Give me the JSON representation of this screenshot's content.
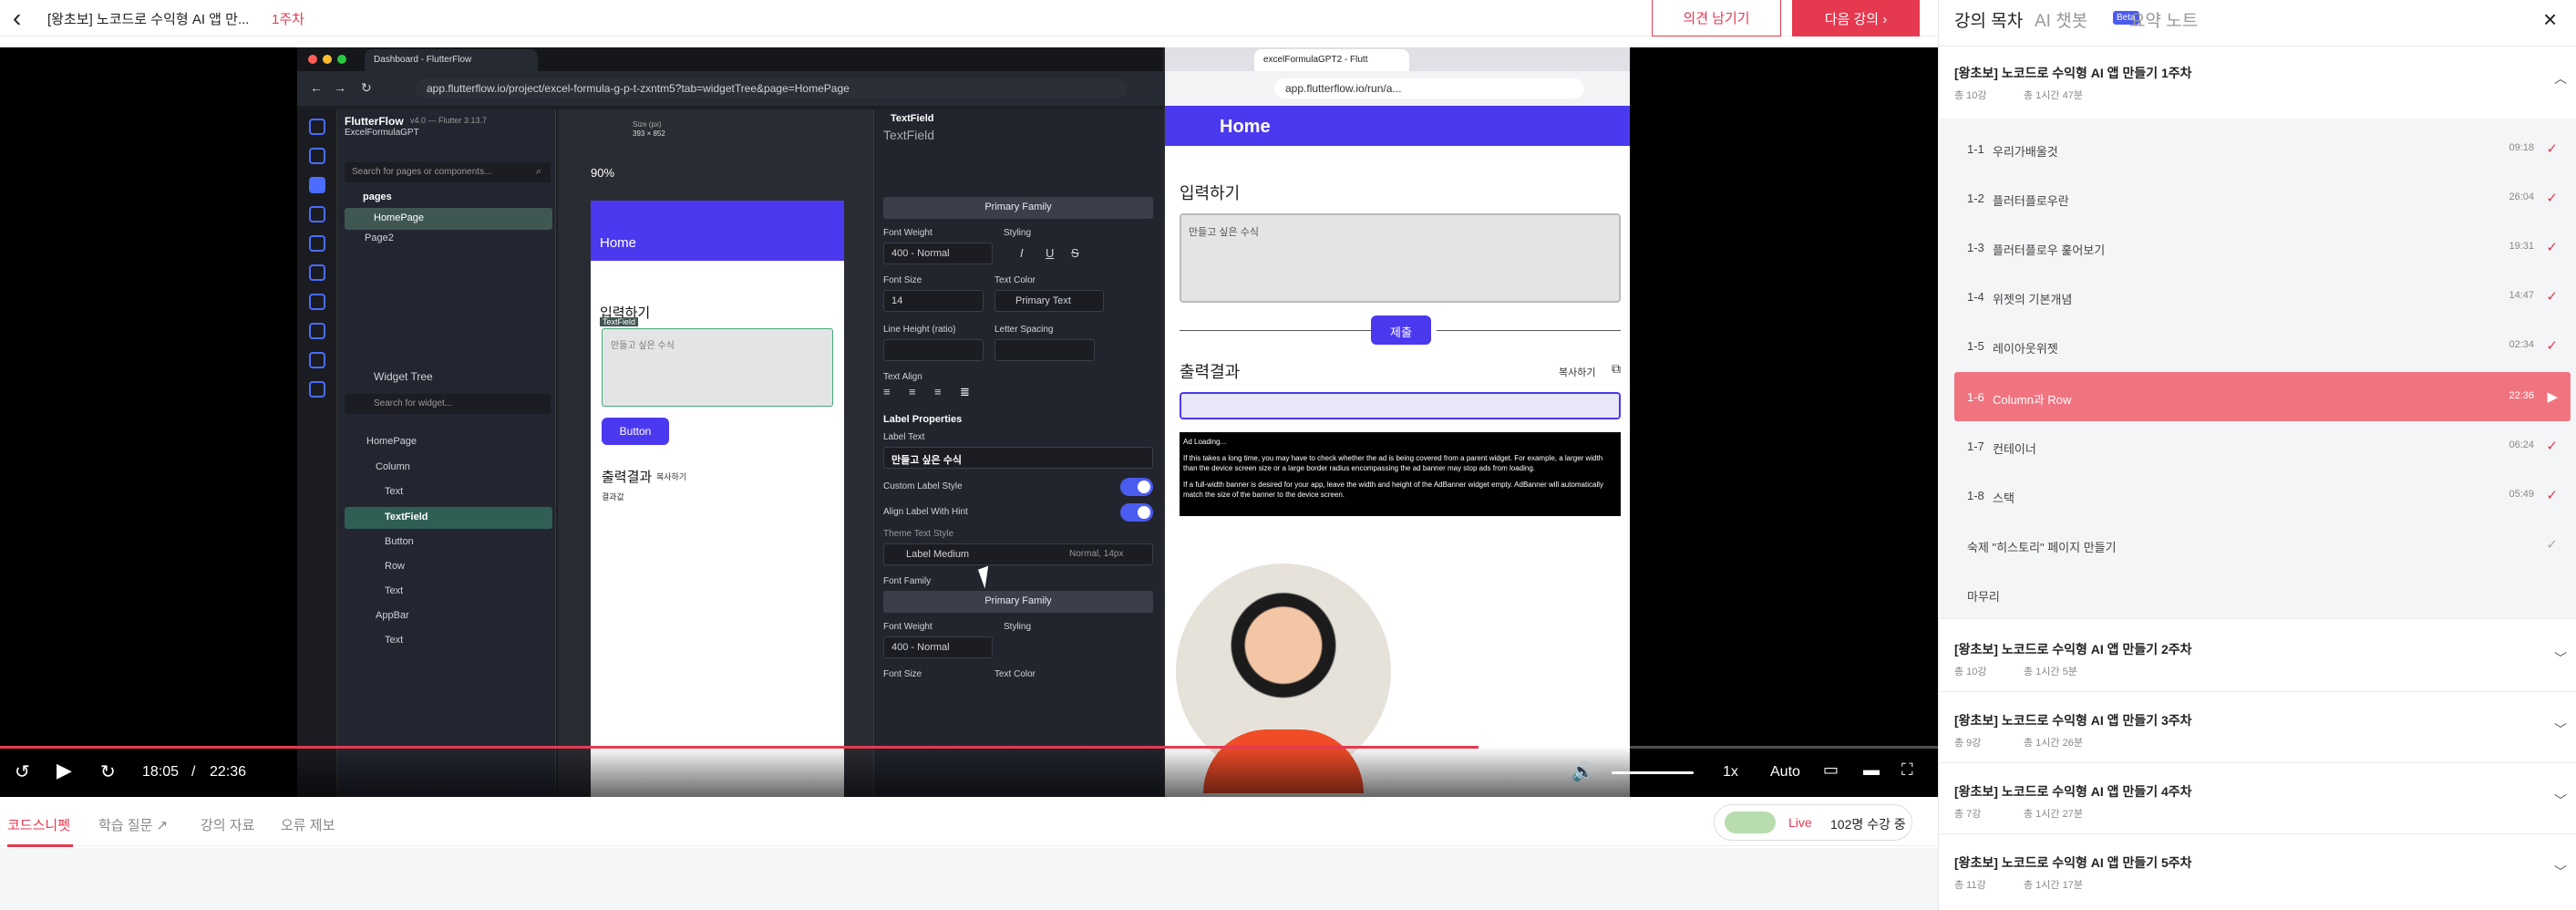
{
  "header": {
    "course_title": "[왕초보] 노코드로 수익형 AI 앱 만...",
    "week": "1주차",
    "feedback_button": "의견 남기기",
    "next_button": "다음 강의 ›"
  },
  "video": {
    "ff_tab": "Dashboard - FlutterFlow",
    "ff_url": "app.flutterflow.io/project/excel-formula-g-p-t-zxntm5?tab=widgetTree&page=HomePage",
    "app_name": "FlutterFlow",
    "app_version": "v4.0 — Flutter 3.13.7",
    "project_name": "ExcelFormulaGPT",
    "zoom": "90%",
    "size_label": "Size (px)",
    "size_value": "393 × 852",
    "search_pages": "Search for pages or components...",
    "pages_label": "pages",
    "page1": "HomePage",
    "page2": "Page2",
    "widget_tree_label": "Widget Tree",
    "search_widget": "Search for widget...",
    "tree": [
      "HomePage",
      "Column",
      "Text",
      "TextField",
      "Button",
      "Row",
      "Text",
      "AppBar",
      "Text"
    ],
    "phone": {
      "appbar_title": "Home",
      "input_heading": "입력하기",
      "textfield_tag": "TextField",
      "hint": "만들고 싶은 수식",
      "button": "Button",
      "output_heading": "출력결과",
      "copy": "복사하기",
      "result": "결과값"
    },
    "props": {
      "title": "TextField",
      "subtitle": "TextField",
      "primary_family": "Primary Family",
      "font_weight_label": "Font Weight",
      "font_weight": "400 - Normal",
      "styling_label": "Styling",
      "font_size_label": "Font Size",
      "font_size": "14",
      "text_color_label": "Text Color",
      "text_color": "Primary Text",
      "line_height_label": "Line Height (ratio)",
      "letter_spacing_label": "Letter Spacing",
      "text_align_label": "Text Align",
      "label_props": "Label Properties",
      "label_text_label": "Label Text",
      "label_text": "만들고 싶은 수식",
      "custom_label_style": "Custom Label Style",
      "align_label": "Align Label With Hint",
      "theme_text_style": "Theme Text Style",
      "label_medium": "Label Medium",
      "label_medium_meta": "Normal, 14px",
      "font_family_label": "Font Family",
      "primary_family2": "Primary Family",
      "font_weight_label2": "Font Weight",
      "font_weight2": "400 - Normal",
      "styling_label2": "Styling",
      "font_size_label2": "Font Size",
      "text_color_label2": "Text Color"
    },
    "run_tab": "excelFormulaGPT2 - Flutt",
    "run_url": "app.flutterflow.io/run/a...",
    "run": {
      "appbar_title": "Home",
      "input_heading": "입력하기",
      "hint": "만들고 싶은 수식",
      "submit": "제출",
      "output_heading": "출력결과",
      "copy": "복사하기",
      "ad_title": "Ad Loading...",
      "ad_p1": "If this takes a long time, you may have to check whether the ad is being covered from a parent widget. For example, a larger width than the device screen size or a large border radius encompassing the ad banner may stop ads from loading.",
      "ad_p2": "If a full-width banner is desired for your app, leave the width and height of the AdBanner widget empty. AdBanner will automatically match the size of the banner to the device screen."
    },
    "controls": {
      "current_time": "18:05",
      "separator": "/",
      "total_time": "22:36",
      "speed": "1x",
      "quality": "Auto",
      "progress": 0.763,
      "volume": 0.9
    }
  },
  "below_tabs": [
    "코드스니펫",
    "학습 질문 ↗",
    "강의 자료",
    "오류 제보"
  ],
  "live": {
    "label": "Live",
    "viewers": "102명 수강 중"
  },
  "sidebar": {
    "tabs": [
      "강의 목차",
      "AI 챗봇",
      "요약 노트"
    ],
    "beta": "Beta",
    "weeks": [
      {
        "title": "[왕초보] 노코드로 수익형 AI 앱 만들기 1주차",
        "count": "총 10강",
        "duration": "총 1시간 47분",
        "lessons": [
          {
            "no": "1-1",
            "title": "우리가배울것",
            "time": "09:18"
          },
          {
            "no": "1-2",
            "title": "플러터플로우란",
            "time": "26:04"
          },
          {
            "no": "1-3",
            "title": "플러터플로우 훑어보기",
            "time": "19:31"
          },
          {
            "no": "1-4",
            "title": "위젯의 기본개념",
            "time": "14:47"
          },
          {
            "no": "1-5",
            "title": "레이아웃위젯",
            "time": "02:34"
          },
          {
            "no": "1-6",
            "title": "Column과 Row",
            "time": "22:36"
          },
          {
            "no": "1-7",
            "title": "컨테이너",
            "time": "06:24"
          },
          {
            "no": "1-8",
            "title": "스택",
            "time": "05:49"
          }
        ],
        "extra": [
          "숙제 \"히스토리\" 페이지 만들기",
          "마무리"
        ]
      },
      {
        "title": "[왕초보] 노코드로 수익형 AI 앱 만들기 2주차",
        "count": "총 10강",
        "duration": "총 1시간 5분"
      },
      {
        "title": "[왕초보] 노코드로 수익형 AI 앱 만들기 3주차",
        "count": "총 9강",
        "duration": "총 1시간 26분"
      },
      {
        "title": "[왕초보] 노코드로 수익형 AI 앱 만들기 4주차",
        "count": "총 7강",
        "duration": "총 1시간 27분"
      },
      {
        "title": "[왕초보] 노코드로 수익형 AI 앱 만들기 5주차",
        "count": "총 11강",
        "duration": "총 1시간 17분"
      }
    ]
  },
  "colors": {
    "accent": "#e53950",
    "flutterflow_blue": "#4b39ef",
    "active_row": "#f07480"
  }
}
